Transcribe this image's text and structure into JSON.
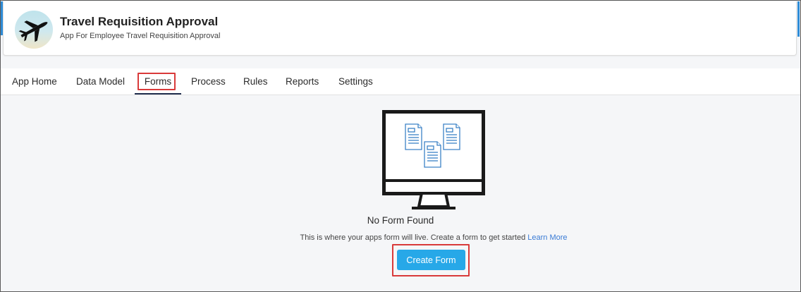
{
  "app": {
    "title": "Travel Requisition Approval",
    "subtitle": "App For Employee Travel Requisition Approval",
    "logo_icon": "airplane-icon"
  },
  "tabs": [
    {
      "label": "App Home"
    },
    {
      "label": "Data Model"
    },
    {
      "label": "Forms",
      "active": true
    },
    {
      "label": "Process"
    },
    {
      "label": "Rules"
    },
    {
      "label": "Reports"
    },
    {
      "label": "Settings"
    }
  ],
  "empty_state": {
    "illustration": "monitor-with-documents-icon",
    "title": "No Form Found",
    "description": "This is where your apps form will live. Create a form to get started",
    "learn_more": "Learn More",
    "create_button": "Create Form"
  },
  "colors": {
    "accent_blue": "#27a8e8",
    "link_blue": "#3a7bd5",
    "highlight_red": "#d93a3a",
    "active_tab_underline": "#1f2d4d",
    "doc_icon_blue": "#3c82c6"
  }
}
